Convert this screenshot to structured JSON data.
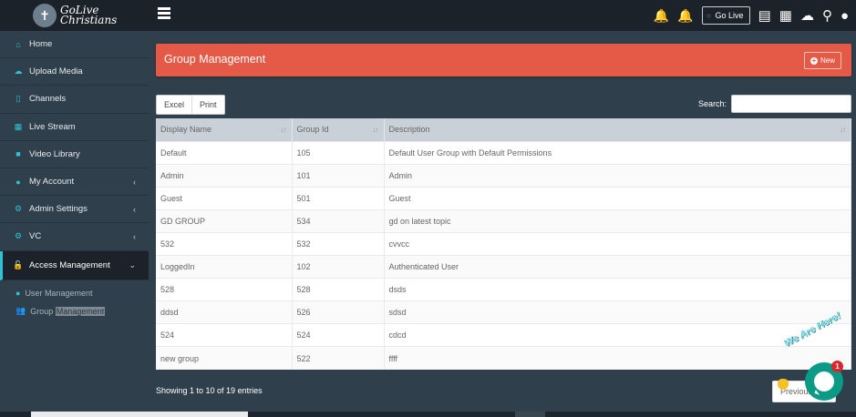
{
  "brand": {
    "logo_line1": "GoLive",
    "logo_line2": "Christians"
  },
  "topbar": {
    "golive_label": "Go Live"
  },
  "sidebar": {
    "items": [
      {
        "label": "Home",
        "icon": "home-icon",
        "has_chevron": false
      },
      {
        "label": "Upload Media",
        "icon": "cloud-upload-icon",
        "has_chevron": false
      },
      {
        "label": "Channels",
        "icon": "bookmark-icon",
        "has_chevron": false
      },
      {
        "label": "Live Stream",
        "icon": "calendar-icon",
        "has_chevron": false
      },
      {
        "label": "Video Library",
        "icon": "video-icon",
        "has_chevron": false
      },
      {
        "label": "My Account",
        "icon": "user-icon",
        "has_chevron": true
      },
      {
        "label": "Admin Settings",
        "icon": "cogs-icon",
        "has_chevron": true
      },
      {
        "label": "VC",
        "icon": "cogs-icon",
        "has_chevron": true
      },
      {
        "label": "Access Management",
        "icon": "unlock-icon",
        "has_chevron": true,
        "active": true
      }
    ],
    "subitems": [
      {
        "label": "User Management",
        "icon": "user-icon"
      },
      {
        "label_prefix": "Group ",
        "label_highlight": "Management",
        "icon": "users-icon"
      }
    ]
  },
  "panel": {
    "title": "Group Management",
    "new_label": "New"
  },
  "toolbar": {
    "excel_label": "Excel",
    "print_label": "Print",
    "search_label": "Search:",
    "search_value": ""
  },
  "table": {
    "columns": [
      "Display Name",
      "Group Id",
      "Description"
    ],
    "rows": [
      [
        "Default",
        "105",
        "Default User Group with Default Permissions"
      ],
      [
        "Admin",
        "101",
        "Admin"
      ],
      [
        "Guest",
        "501",
        "Guest"
      ],
      [
        "GD GROUP",
        "534",
        "gd on latest topic"
      ],
      [
        "532",
        "532",
        "cvvcc"
      ],
      [
        "LoggedIn",
        "102",
        "Authenticated User"
      ],
      [
        "528",
        "528",
        "dsds"
      ],
      [
        "ddsd",
        "526",
        "sdsd"
      ],
      [
        "524",
        "524",
        "cdcd"
      ],
      [
        "new group",
        "522",
        "ffff"
      ]
    ]
  },
  "footer": {
    "info": "Showing 1 to 10 of 19 entries",
    "previous_label": "Previous"
  },
  "chat": {
    "tagline": "We Are Here!",
    "badge_count": "1"
  },
  "colors": {
    "accent": "#2ec3d6",
    "panel_header": "#e55a47",
    "sidebar_bg": "#2f3f4b",
    "topbar_bg": "#1c2229"
  }
}
